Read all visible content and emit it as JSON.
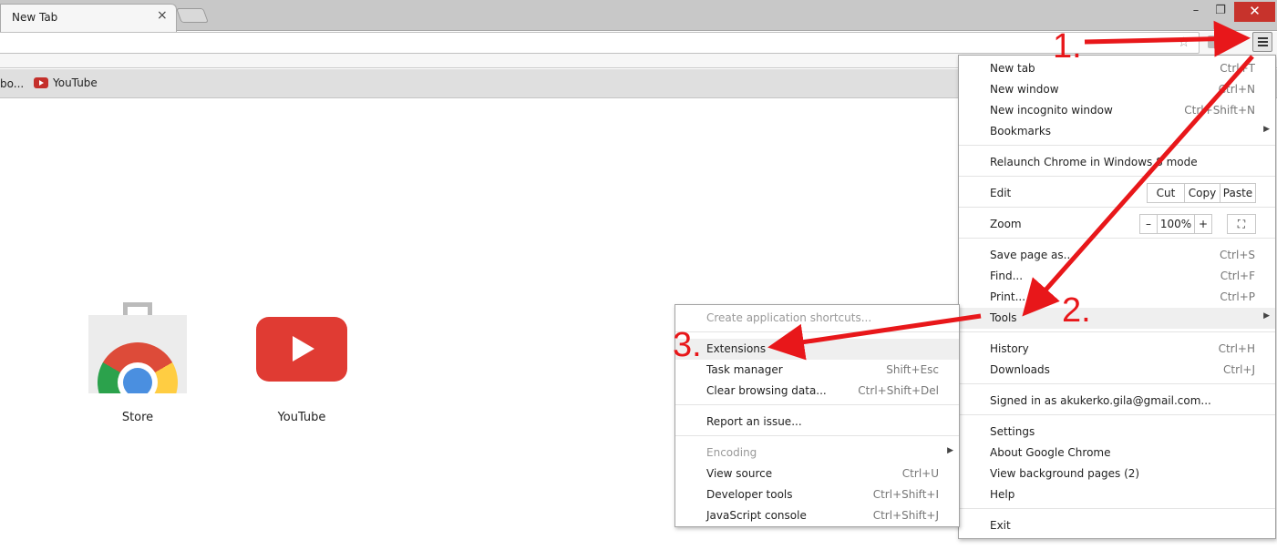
{
  "tab": {
    "title": "New Tab",
    "close_glyph": "×"
  },
  "window": {
    "minimize_glyph": "–",
    "restore_glyph": "❐",
    "close_glyph": "✕"
  },
  "toolbar": {
    "star_glyph": "☆",
    "menu_icon": "hamburger-menu-icon"
  },
  "bookmarks": [
    {
      "label": "bo..."
    },
    {
      "label": "YouTube",
      "icon": "youtube-icon"
    }
  ],
  "apps": [
    {
      "label": "Store",
      "icon": "chrome-web-store-icon"
    },
    {
      "label": "YouTube",
      "icon": "youtube-icon"
    }
  ],
  "main_menu": {
    "new_tab": {
      "label": "New tab",
      "shortcut": "Ctrl+T"
    },
    "new_window": {
      "label": "New window",
      "shortcut": "Ctrl+N"
    },
    "new_incognito": {
      "label": "New incognito window",
      "shortcut": "Ctrl+Shift+N"
    },
    "bookmarks": {
      "label": "Bookmarks"
    },
    "relaunch": {
      "label": "Relaunch Chrome in Windows 8 mode"
    },
    "edit": {
      "label": "Edit",
      "cut": "Cut",
      "copy": "Copy",
      "paste": "Paste"
    },
    "zoom": {
      "label": "Zoom",
      "minus": "–",
      "value": "100%",
      "plus": "+",
      "fullscreen": "⛶"
    },
    "save_page": {
      "label": "Save page as...",
      "shortcut": "Ctrl+S"
    },
    "find": {
      "label": "Find...",
      "shortcut": "Ctrl+F"
    },
    "print": {
      "label": "Print...",
      "shortcut": "Ctrl+P"
    },
    "tools": {
      "label": "Tools"
    },
    "history": {
      "label": "History",
      "shortcut": "Ctrl+H"
    },
    "downloads": {
      "label": "Downloads",
      "shortcut": "Ctrl+J"
    },
    "signed_in": {
      "label": "Signed in as akukerko.gila@gmail.com..."
    },
    "settings": {
      "label": "Settings"
    },
    "about": {
      "label": "About Google Chrome"
    },
    "background_pages": {
      "label": "View background pages (2)"
    },
    "help": {
      "label": "Help"
    },
    "exit": {
      "label": "Exit"
    }
  },
  "tools_menu": {
    "create_shortcuts": {
      "label": "Create application shortcuts..."
    },
    "extensions": {
      "label": "Extensions"
    },
    "task_manager": {
      "label": "Task manager",
      "shortcut": "Shift+Esc"
    },
    "clear_browsing": {
      "label": "Clear browsing data...",
      "shortcut": "Ctrl+Shift+Del"
    },
    "report_issue": {
      "label": "Report an issue..."
    },
    "encoding": {
      "label": "Encoding"
    },
    "view_source": {
      "label": "View source",
      "shortcut": "Ctrl+U"
    },
    "developer_tools": {
      "label": "Developer tools",
      "shortcut": "Ctrl+Shift+I"
    },
    "js_console": {
      "label": "JavaScript console",
      "shortcut": "Ctrl+Shift+J"
    }
  },
  "annotations": {
    "step1": "1.",
    "step2": "2.",
    "step3": "3.",
    "color": "#e8171a"
  }
}
